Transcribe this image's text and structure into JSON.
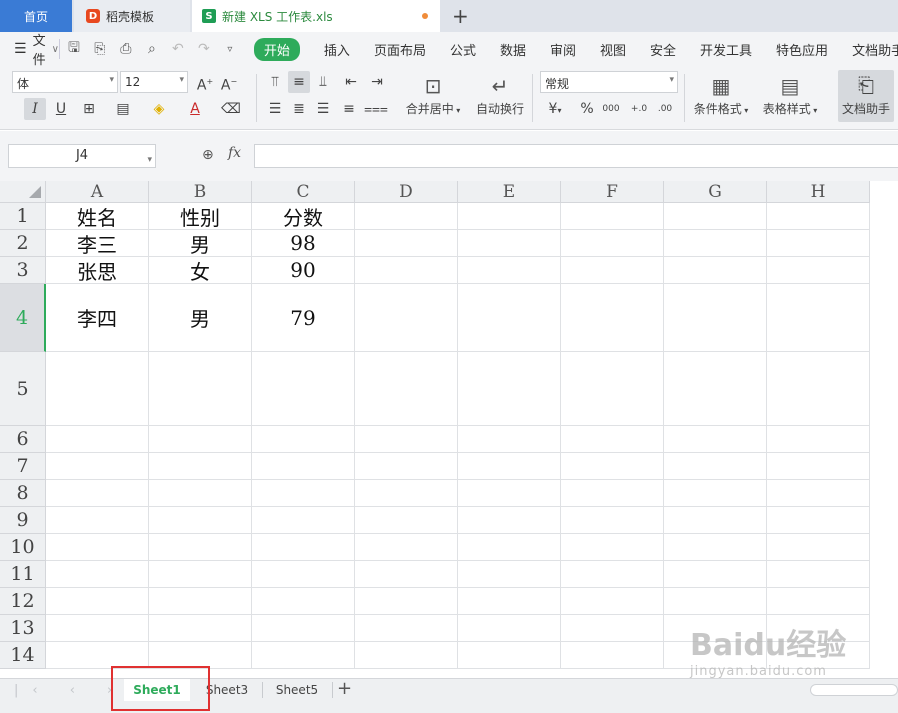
{
  "tabs": {
    "home": "首页",
    "template": "稻壳模板",
    "document": "新建 XLS 工作表.xls",
    "new_tab": "+"
  },
  "menu": {
    "file": "文件",
    "items": [
      "开始",
      "插入",
      "页面布局",
      "公式",
      "数据",
      "审阅",
      "视图",
      "安全",
      "开发工具",
      "特色应用",
      "文档助手"
    ],
    "active_index": 0
  },
  "ribbon": {
    "font_name": "体",
    "font_size": "12",
    "number_format": "常规",
    "merge_label": "合并居中",
    "wrap_label": "自动换行",
    "cond_format_label": "条件格式",
    "table_style_label": "表格样式",
    "doc_helper_label": "文档助手",
    "percent_symbol": "%",
    "thousands_symbol": "000",
    "inc_decimal": "+.0\n.00",
    "dec_decimal": ".00\n+.0"
  },
  "formula_bar": {
    "name_box": "J4",
    "fx_label": "fx",
    "value": ""
  },
  "columns": [
    "A",
    "B",
    "C",
    "D",
    "E",
    "F",
    "G",
    "H"
  ],
  "rows": [
    "1",
    "2",
    "3",
    "4",
    "5",
    "6",
    "7",
    "8",
    "9",
    "10",
    "11",
    "12",
    "13",
    "14"
  ],
  "active_row": "4",
  "cells": [
    [
      "姓名",
      "性别",
      "分数"
    ],
    [
      "李三",
      "男",
      "98"
    ],
    [
      "张思",
      "女",
      "90"
    ],
    [
      "李四",
      "男",
      "79"
    ]
  ],
  "sheets": [
    "Sheet1",
    "Sheet3",
    "Sheet5"
  ],
  "active_sheet": "Sheet1",
  "add_sheet": "+",
  "watermark": {
    "main": "Baidu经验",
    "sub": "jingyan.baidu.com"
  },
  "colors": {
    "accent_green": "#2eab5b",
    "home_tab_blue": "#3a7bd5",
    "highlight_red": "#e03131"
  }
}
